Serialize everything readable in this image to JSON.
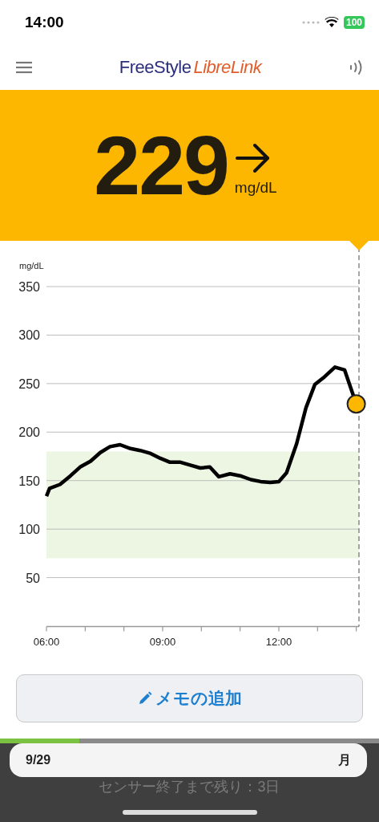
{
  "status_bar": {
    "time": "14:00",
    "battery": "100"
  },
  "header": {
    "logo_primary": "FreeStyle",
    "logo_secondary": "LibreLink"
  },
  "reading": {
    "value": "229",
    "unit": "mg/dL"
  },
  "chart": {
    "chart_data": {
      "type": "line",
      "ylabel": "mg/dL",
      "xlim": [
        6,
        14.07
      ],
      "ylim": [
        0,
        350
      ],
      "grid": true,
      "yticks": [
        50,
        100,
        150,
        200,
        250,
        300,
        350
      ],
      "xticks": [
        {
          "value": 6,
          "label": "06:00"
        },
        {
          "value": 9,
          "label": "09:00"
        },
        {
          "value": 12,
          "label": "12:00"
        }
      ],
      "x": [
        6.0,
        6.08,
        6.35,
        6.62,
        6.87,
        7.14,
        7.39,
        7.64,
        7.9,
        8.17,
        8.42,
        8.69,
        8.94,
        9.19,
        9.46,
        9.71,
        9.97,
        10.22,
        10.45,
        10.74,
        11.0,
        11.28,
        11.53,
        11.78,
        12.0,
        12.2,
        12.46,
        12.7,
        12.93,
        13.18,
        13.45,
        13.7,
        14.0
      ],
      "series": [
        {
          "color": "#000000",
          "values": [
            134,
            142,
            146,
            155,
            164,
            170,
            179,
            185,
            187,
            183,
            181,
            178,
            173,
            169,
            169,
            166,
            163,
            164,
            154,
            157,
            155,
            151,
            149,
            148,
            149,
            158,
            188,
            225,
            249,
            257,
            267,
            264,
            229
          ]
        }
      ],
      "bands": [
        {
          "axis": "y",
          "from": 70,
          "to": 180
        }
      ]
    }
  },
  "memo_button": {
    "label": "メモの追加"
  },
  "sensor": {
    "level": 0.21,
    "date": "9/29",
    "weekday": "月",
    "remaining": "センサー終了まで残り：3日"
  }
}
